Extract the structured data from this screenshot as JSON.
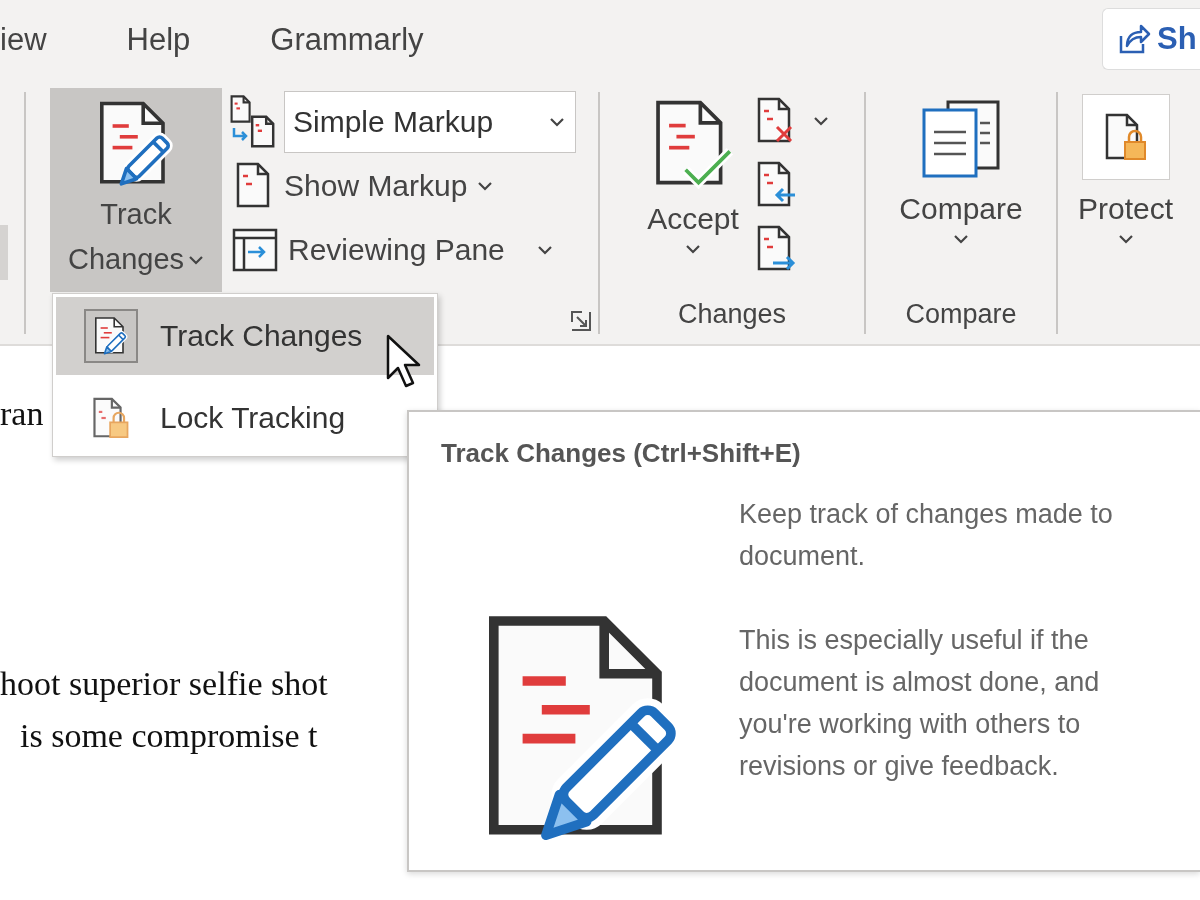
{
  "ribbon_tabs": [
    {
      "label": "iew",
      "selected": false
    },
    {
      "label": "Help",
      "selected": false
    },
    {
      "label": "Grammarly",
      "selected": false
    }
  ],
  "share_button": {
    "label": "Sh"
  },
  "tracking_group": {
    "track_changes": {
      "label_lines": [
        "Track",
        "Changes"
      ],
      "pressed": true
    },
    "markup_dropdown": {
      "value": "Simple Markup"
    },
    "show_markup": {
      "label": "Show Markup"
    },
    "reviewing_pane": {
      "label": "Reviewing Pane"
    }
  },
  "changes_group": {
    "label": "Changes",
    "accept": {
      "label": "Accept"
    }
  },
  "compare_group": {
    "label": "Compare",
    "compare": {
      "label": "Compare"
    }
  },
  "protect_group": {
    "protect": {
      "label": "Protect"
    }
  },
  "track_menu": {
    "items": [
      {
        "label": "Track Changes",
        "selected": true,
        "checked": true
      },
      {
        "label": "Lock Tracking",
        "selected": false,
        "checked": false
      }
    ]
  },
  "tooltip": {
    "title": "Track Changes (Ctrl+Shift+E)",
    "paragraphs": [
      {
        "lines": [
          "Keep track of changes made to",
          "document."
        ]
      },
      {
        "lines": [
          "This is especially useful if the",
          "document is almost done, and",
          "you're working with others to",
          "revisions or give feedback."
        ]
      }
    ]
  },
  "document": {
    "lines": [
      "ran",
      "hoot superior selfie shot",
      "is some compromise t"
    ]
  }
}
